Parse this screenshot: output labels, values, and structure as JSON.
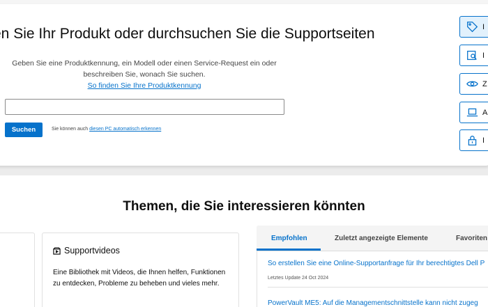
{
  "search": {
    "title": "en Sie Ihr Produkt oder durchsuchen Sie die Supportseiten",
    "description": "Geben Sie eine Produktkennung, ein Modell oder einen Service-Request ein oder beschreiben Sie, wonach Sie suchen.",
    "find_link": "So finden Sie Ihre Produktkennung",
    "input_value": "",
    "button_label": "Suchen",
    "auto_prefix": "Sie können auch ",
    "auto_link": "diesen PC automatisch erkennen"
  },
  "side_buttons": [
    {
      "icon": "tag-icon",
      "label": "I"
    },
    {
      "icon": "order-search-icon",
      "label": "I"
    },
    {
      "icon": "eye-icon",
      "label": "Z"
    },
    {
      "icon": "laptop-icon",
      "label": "A"
    },
    {
      "icon": "lock-icon",
      "label": "I"
    }
  ],
  "topics": {
    "title": "Themen, die Sie interessieren könnten"
  },
  "video_card": {
    "title": "Supportvideos",
    "description": "Eine Bibliothek mit Videos, die Ihnen helfen, Funktionen zu entdecken, Probleme zu beheben und vieles mehr."
  },
  "tabs": [
    {
      "label": "Empfohlen"
    },
    {
      "label": "Zuletzt angezeigte Elemente"
    },
    {
      "label": "Favoriten"
    }
  ],
  "articles": [
    {
      "title": "So erstellen Sie eine Online-Supportanfrage für Ihr berechtigtes Dell P",
      "meta": "Letztes Update 24 Oct 2024"
    },
    {
      "title": "PowerVault ME5: Auf die Managementschnittstelle kann nicht zugeg"
    }
  ],
  "colors": {
    "accent": "#0672cb",
    "active_tab_bg": "#e2f1fc"
  }
}
